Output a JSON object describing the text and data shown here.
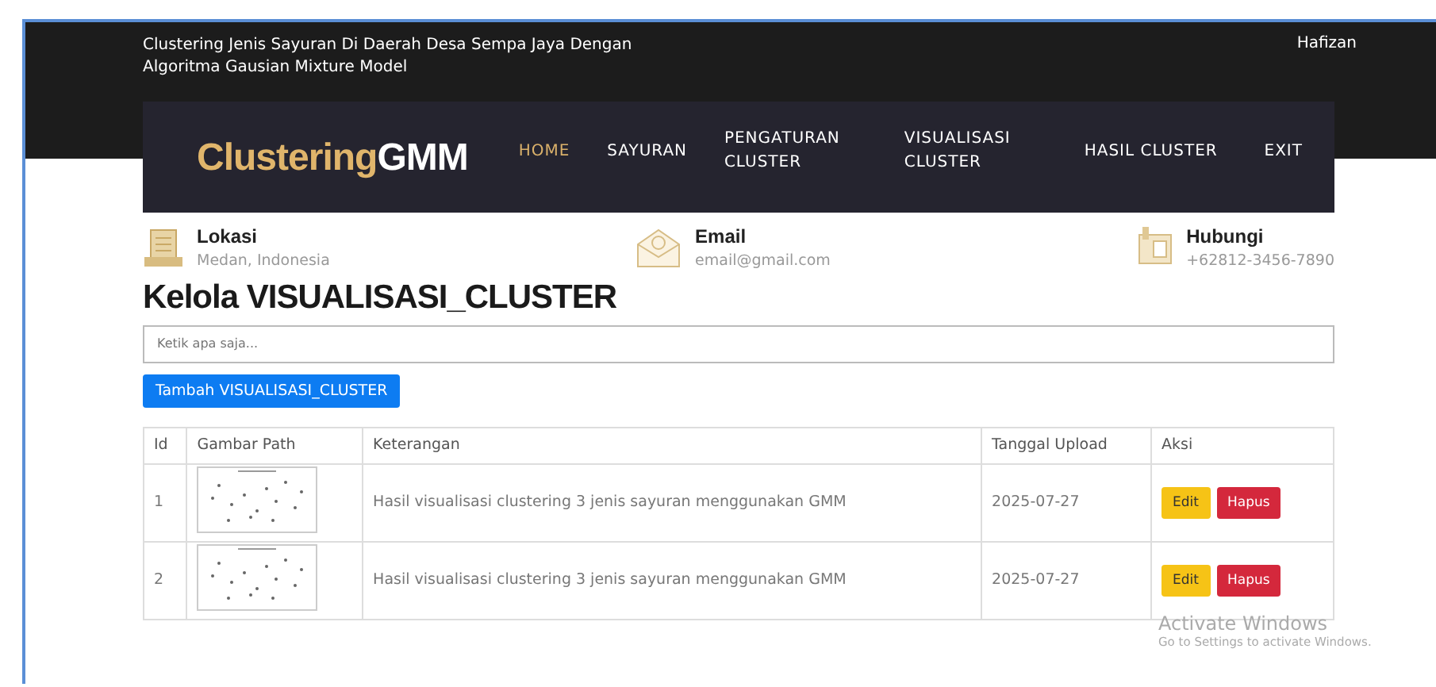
{
  "top_bar": {
    "title": "Clustering Jenis Sayuran Di Daerah Desa Sempa Jaya Dengan Algoritma Gausian Mixture Model",
    "user": "Hafizan"
  },
  "logo": {
    "part_1": "Clustering",
    "part_2": "GMM"
  },
  "nav": [
    {
      "label": "HOME",
      "selected": true
    },
    {
      "label": "SAYURAN",
      "selected": false
    },
    {
      "label": "PENGATURAN CLUSTER",
      "selected": false
    },
    {
      "label": "VISUALISASI CLUSTER",
      "selected": false
    },
    {
      "label": "HASIL CLUSTER",
      "selected": false
    },
    {
      "label": "EXIT",
      "selected": false
    }
  ],
  "info": [
    {
      "kind": "building",
      "title": "Lokasi",
      "value": "Medan, Indonesia"
    },
    {
      "kind": "mail",
      "title": "Email",
      "value": "email@gmail.com"
    },
    {
      "kind": "phone",
      "title": "Hubungi",
      "value": "+62812-3456-7890"
    }
  ],
  "heading": "Kelola VISUALISASI_CLUSTER",
  "search": {
    "placeholder": "Ketik apa saja..."
  },
  "add_button": "Tambah VISUALISASI_CLUSTER",
  "table": {
    "columns": [
      "Id",
      "Gambar Path",
      "Keterangan",
      "Tanggal Upload",
      "Aksi"
    ],
    "rows": [
      {
        "id": "1",
        "description": "Hasil visualisasi clustering 3 jenis sayuran menggunakan GMM",
        "date": "2025-07-27",
        "actions": [
          "Edit",
          "Hapus"
        ]
      },
      {
        "id": "2",
        "description": "Hasil visualisasi clustering 3 jenis sayuran menggunakan GMM",
        "date": "2025-07-27",
        "actions": [
          "Edit",
          "Hapus"
        ]
      }
    ]
  },
  "os_notice": {
    "title": "Activate Windows",
    "text": "Go to Settings to activate Windows."
  }
}
